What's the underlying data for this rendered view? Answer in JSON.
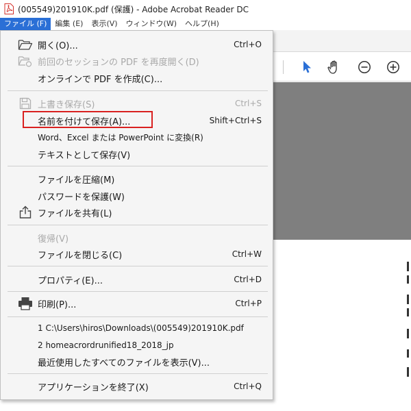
{
  "window": {
    "title": "(005549)201910K.pdf (保護) - Adobe Acrobat Reader DC"
  },
  "menubar": {
    "items": [
      {
        "label": "ファイル (F)"
      },
      {
        "label": "編集 (E)"
      },
      {
        "label": "表示(V)"
      },
      {
        "label": "ウィンドウ(W)"
      },
      {
        "label": "ヘルプ(H)"
      }
    ]
  },
  "file_menu": {
    "open": {
      "label": "開く(O)...",
      "shortcut": "Ctrl+O"
    },
    "reopen_session": {
      "label": "前回のセッションの PDF を再度開く(D)"
    },
    "create_pdf_online": {
      "label": "オンラインで PDF を作成(C)..."
    },
    "save": {
      "label": "上書き保存(S)",
      "shortcut": "Ctrl+S"
    },
    "save_as": {
      "label": "名前を付けて保存(A)...",
      "shortcut": "Shift+Ctrl+S"
    },
    "convert": {
      "label": "Word、Excel または PowerPoint に変換(R)"
    },
    "save_as_text": {
      "label": "テキストとして保存(V)"
    },
    "compress": {
      "label": "ファイルを圧縮(M)"
    },
    "protect_password": {
      "label": "パスワードを保護(W)"
    },
    "share": {
      "label": "ファイルを共有(L)"
    },
    "revert": {
      "label": "復帰(V)"
    },
    "close": {
      "label": "ファイルを閉じる(C)",
      "shortcut": "Ctrl+W"
    },
    "properties": {
      "label": "プロパティ(E)...",
      "shortcut": "Ctrl+D"
    },
    "print": {
      "label": "印刷(P)...",
      "shortcut": "Ctrl+P"
    },
    "recent_1": {
      "label": "1 C:\\Users\\hiros\\Downloads\\(005549)201910K.pdf"
    },
    "recent_2": {
      "label": "2 homeacrordrunified18_2018_jp"
    },
    "show_all_recent": {
      "label": "最近使用したすべてのファイルを表示(V)..."
    },
    "exit": {
      "label": "アプリケーションを終了(X)",
      "shortcut": "Ctrl+Q"
    }
  },
  "colors": {
    "menu_active_bg": "#2a6fd6",
    "highlight_border": "#d9201f",
    "pdf_icon": "#d4302a",
    "select_tool": "#2a6fd6"
  },
  "icons": {
    "title": "pdf-icon",
    "open": "folder-open-icon",
    "reopen": "reopen-session-icon",
    "save": "floppy-disk-icon",
    "share": "share-upload-icon",
    "print": "printer-icon",
    "toolbar": [
      "select-arrow-icon",
      "hand-tool-icon",
      "zoom-out-icon",
      "zoom-in-icon"
    ]
  }
}
